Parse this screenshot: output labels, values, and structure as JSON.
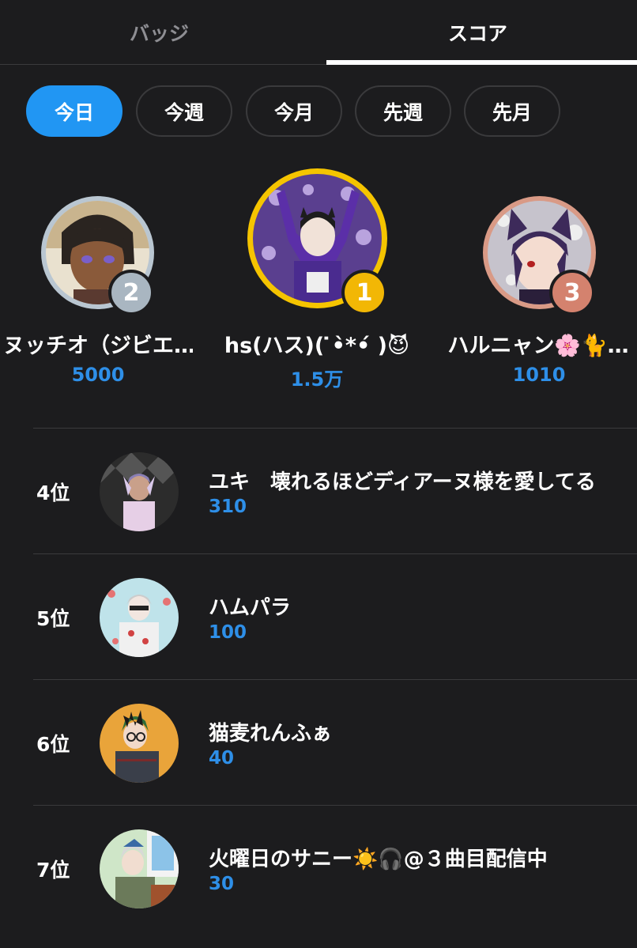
{
  "tabs": [
    {
      "label": "バッジ",
      "active": false
    },
    {
      "label": "スコア",
      "active": true
    }
  ],
  "periods": [
    {
      "label": "今日",
      "selected": true
    },
    {
      "label": "今週",
      "selected": false
    },
    {
      "label": "今月",
      "selected": false
    },
    {
      "label": "先週",
      "selected": false
    },
    {
      "label": "先月",
      "selected": false
    }
  ],
  "podium": [
    {
      "rank": "2",
      "name": "ヌッチオ（ジビエ…",
      "score": "5000",
      "ring_color": "#b9c6d1",
      "badge_color": "#a9b6c1"
    },
    {
      "rank": "1",
      "name": "hs(ハス)( ̇•̀*•́ )😈",
      "score": "1.5万",
      "ring_color": "#f5c400",
      "badge_color": "#f2b705"
    },
    {
      "rank": "3",
      "name": "ハルニャン🌸🐈…",
      "score": "1010",
      "ring_color": "#d99a86",
      "badge_color": "#d4826e"
    }
  ],
  "list": [
    {
      "rank": "4位",
      "name": "ユキ　壊れるほどディアーヌ様を愛してる",
      "score": "310"
    },
    {
      "rank": "5位",
      "name": "ハムパラ",
      "score": "100"
    },
    {
      "rank": "6位",
      "name": "猫麦れんふぁ",
      "score": "40"
    },
    {
      "rank": "7位",
      "name": "火曜日のサニー☀️🎧@３曲目配信中",
      "score": "30"
    }
  ],
  "colors": {
    "accent": "#2196f3",
    "score": "#2e8fe8",
    "background": "#1c1c1e"
  }
}
